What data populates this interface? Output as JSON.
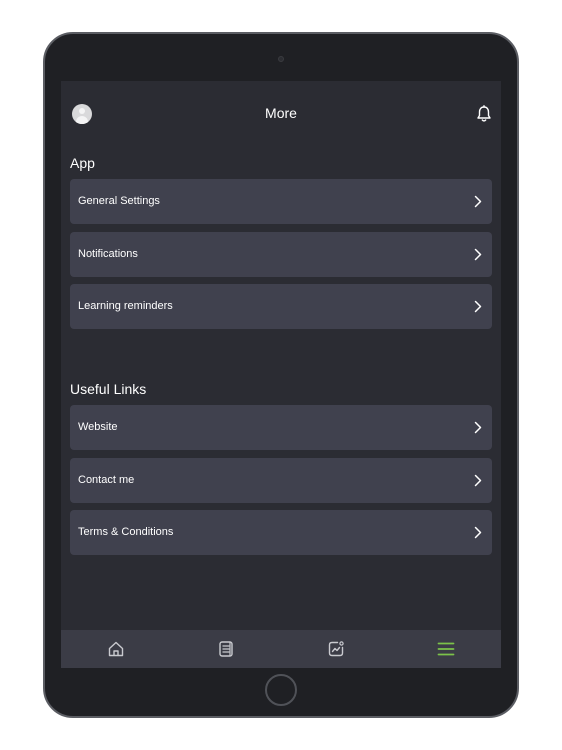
{
  "header": {
    "title": "More",
    "avatar_icon": "user-avatar-icon",
    "right_icon": "bell-icon"
  },
  "sections": [
    {
      "title": "App",
      "items": [
        {
          "label": "General Settings",
          "icon": "chevron-right-icon"
        },
        {
          "label": "Notifications",
          "icon": "chevron-right-icon"
        },
        {
          "label": "Learning reminders",
          "icon": "chevron-right-icon"
        }
      ]
    },
    {
      "title": "Useful Links",
      "items": [
        {
          "label": "Website",
          "icon": "chevron-right-icon"
        },
        {
          "label": "Contact me",
          "icon": "chevron-right-icon"
        },
        {
          "label": "Terms & Conditions",
          "icon": "chevron-right-icon"
        }
      ]
    }
  ],
  "tabbar": {
    "tabs": [
      {
        "icon": "home-icon",
        "active": false
      },
      {
        "icon": "notebook-icon",
        "active": false
      },
      {
        "icon": "progress-chart-icon",
        "active": false
      },
      {
        "icon": "menu-icon",
        "active": true
      }
    ]
  },
  "colors": {
    "background": "#2b2c33",
    "card": "#40414e",
    "tabbar": "#3b3c46",
    "accent": "#7cc24a",
    "icon_inactive": "#c9cacf",
    "text": "#ffffff"
  }
}
